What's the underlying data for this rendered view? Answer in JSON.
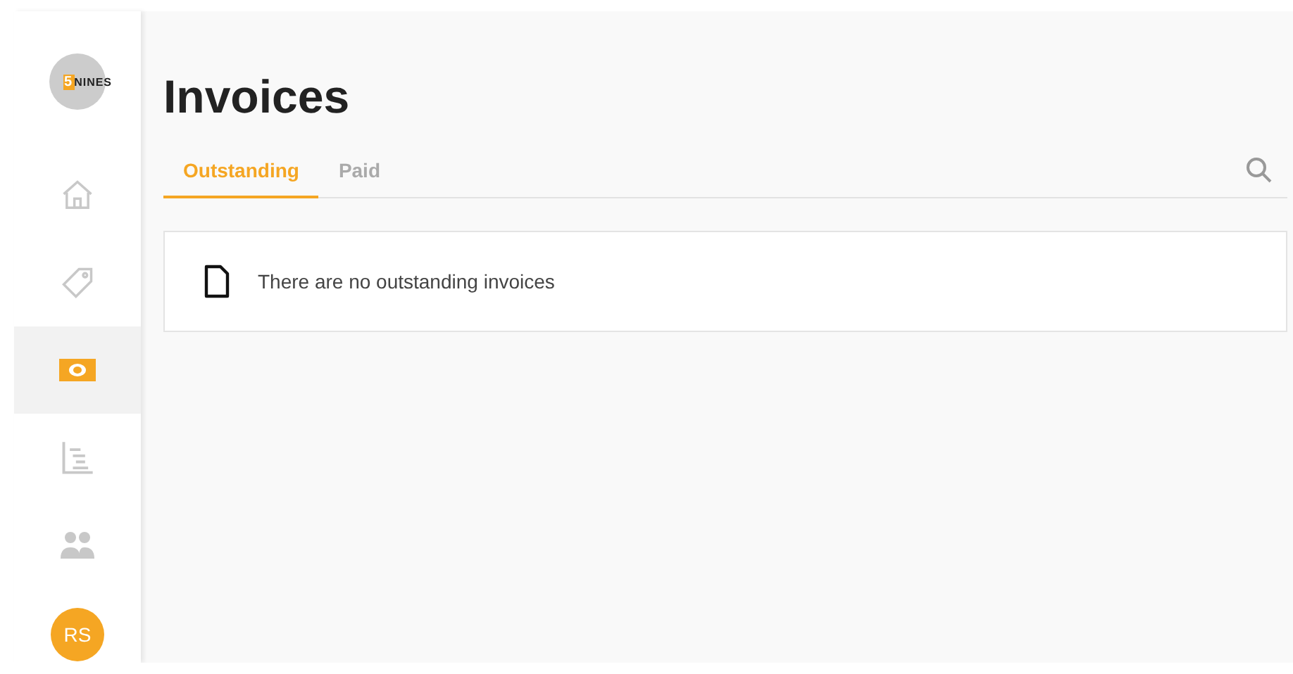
{
  "sidebar": {
    "logo": {
      "digit": "5",
      "word": "NINES"
    },
    "items": [
      {
        "kind": "home",
        "selected": false
      },
      {
        "kind": "tag",
        "selected": false
      },
      {
        "kind": "money",
        "selected": true
      },
      {
        "kind": "chart",
        "selected": false
      },
      {
        "kind": "people",
        "selected": false
      }
    ],
    "avatar": "RS"
  },
  "page": {
    "title": "Invoices",
    "tabs": [
      {
        "label": "Outstanding",
        "selected": true
      },
      {
        "label": "Paid",
        "selected": false
      }
    ],
    "empty_message": "There are no outstanding invoices"
  }
}
